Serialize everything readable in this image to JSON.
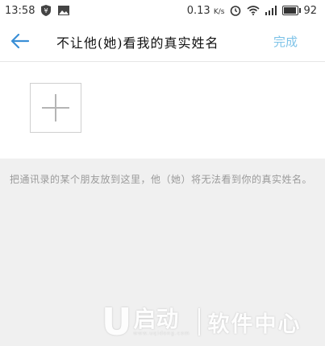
{
  "status_bar": {
    "time": "13:58",
    "network_speed": "0.13",
    "network_speed_unit": "K/s",
    "battery_level": "92",
    "battery_fraction": 0.92
  },
  "header": {
    "title": "不让他(她)看我的真实姓名",
    "done_label": "完成",
    "back_icon": "arrow-left-icon",
    "accent_color": "#7ec3e8"
  },
  "main": {
    "add_icon": "plus-icon",
    "hint": "把通讯录的某个朋友放到这里，他（她）将无法看到你的真实姓名。"
  },
  "watermark": {
    "letter": "U",
    "brand": "启动",
    "brand_sub": "www.uqidong.com",
    "tagline": "软件中心"
  }
}
